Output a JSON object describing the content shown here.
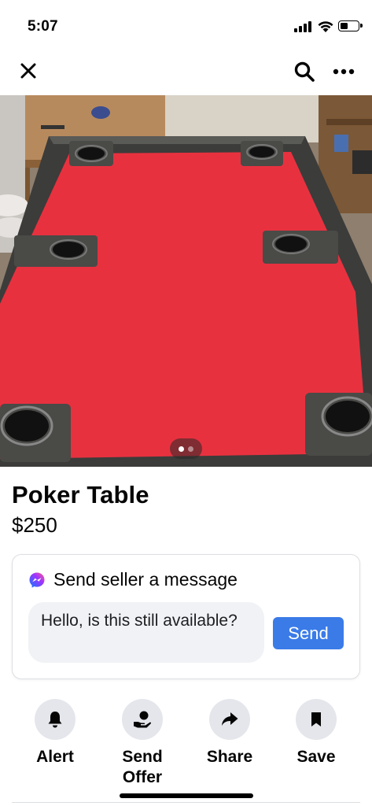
{
  "status_bar": {
    "time": "5:07"
  },
  "nav": {
    "icons": [
      "close-icon",
      "search-icon",
      "more-icon"
    ]
  },
  "photo": {
    "pager": {
      "count": 2,
      "active_index": 0
    },
    "colors": {
      "felt": "#e8313f",
      "rail": "#3e3e3c",
      "floor": "#9a8b7a"
    }
  },
  "listing": {
    "title": "Poker Table",
    "price": "$250"
  },
  "message_card": {
    "header": "Send seller a message",
    "icon": "messenger-icon",
    "input_value": "Hello, is this still available?",
    "send_label": "Send"
  },
  "actions": [
    {
      "label": "Alert",
      "icon": "bell-icon"
    },
    {
      "label": "Send Offer",
      "icon": "offer-hand-icon"
    },
    {
      "label": "Share",
      "icon": "share-arrow-icon"
    },
    {
      "label": "Save",
      "icon": "bookmark-icon"
    }
  ],
  "colors": {
    "accent": "#3a7be8",
    "action_circle": "#e4e6eb",
    "input_bg": "#f0f2f5"
  }
}
